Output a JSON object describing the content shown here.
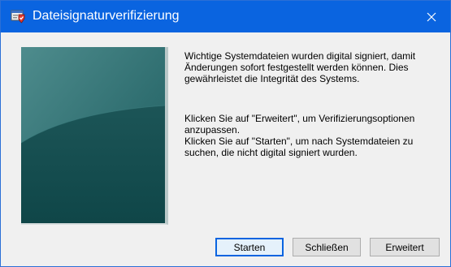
{
  "window": {
    "title": "Dateisignaturverifizierung",
    "title_icon": "app-shield-icon",
    "close_icon": "close-icon",
    "accent_color": "#0a64e0"
  },
  "content": {
    "paragraph1": "Wichtige Systemdateien wurden digital signiert, damit Änderungen sofort festgestellt werden können. Dies gewährleistet die Integrität des Systems.",
    "paragraph2_line1": "Klicken Sie auf \"Erweitert\", um Verifizierungsoptionen anzupassen.",
    "paragraph2_line2": "Klicken Sie auf \"Starten\", um nach Systemdateien zu suchen, die nicht digital signiert wurden."
  },
  "buttons": {
    "start_label": "Starten",
    "close_label": "Schließen",
    "advanced_label": "Erweitert"
  }
}
